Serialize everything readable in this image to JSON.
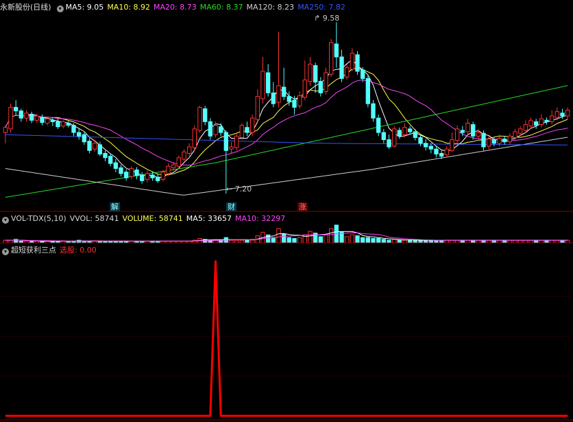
{
  "header": {
    "title": "永新股份(日线)",
    "ma": [
      {
        "label": "MA5: 9.05",
        "color": "#ffffff"
      },
      {
        "label": "MA10: 8.92",
        "color": "#ffff55"
      },
      {
        "label": "MA20: 8.73",
        "color": "#ff44ff"
      },
      {
        "label": "MA60: 8.37",
        "color": "#22dd22"
      },
      {
        "label": "MA120: 8.23",
        "color": "#d0d0d0"
      },
      {
        "label": "MA250: 7.82",
        "color": "#3355ff"
      }
    ]
  },
  "price_panel": {
    "high_label": "9.58",
    "low_label": "7.20",
    "events": [
      {
        "text": "解",
        "kind": "down"
      },
      {
        "text": "财",
        "kind": "down"
      },
      {
        "text": "涨",
        "kind": "up"
      }
    ]
  },
  "volume_header": {
    "name": "VOL-TDX(5,10)",
    "items": [
      {
        "label": "VVOL: 58741",
        "color": "#d8d8d8"
      },
      {
        "label": "VOLUME: 58741",
        "color": "#ffff55"
      },
      {
        "label": "MA5: 33657",
        "color": "#ffffff"
      },
      {
        "label": "MA10: 32297",
        "color": "#ff44ff"
      }
    ]
  },
  "indicator_header": {
    "name": "超短获利三点",
    "items": [
      {
        "label": "选股: 0.00",
        "color": "#ff3030"
      }
    ]
  },
  "colors": {
    "up": "#ff3232",
    "down": "#54ffff",
    "signal": "#ff0000",
    "grid": "#7a0000"
  },
  "chart_data": {
    "type": "candlestick",
    "candles": [
      [
        8.05,
        8.12,
        7.9,
        8.15
      ],
      [
        8.1,
        8.4,
        8.05,
        8.45
      ],
      [
        8.4,
        8.35,
        8.28,
        8.5
      ],
      [
        8.35,
        8.25,
        8.2,
        8.38
      ],
      [
        8.25,
        8.32,
        8.2,
        8.36
      ],
      [
        8.3,
        8.22,
        8.18,
        8.34
      ],
      [
        8.22,
        8.28,
        8.18,
        8.31
      ],
      [
        8.26,
        8.19,
        8.15,
        8.3
      ],
      [
        8.18,
        8.24,
        8.15,
        8.27
      ],
      [
        8.22,
        8.2,
        8.14,
        8.26
      ],
      [
        8.2,
        8.13,
        8.1,
        8.24
      ],
      [
        8.14,
        8.2,
        8.11,
        8.22
      ],
      [
        8.18,
        8.15,
        8.12,
        8.21
      ],
      [
        8.15,
        8.05,
        8.0,
        8.18
      ],
      [
        8.05,
        8.0,
        7.95,
        8.1
      ],
      [
        8.02,
        7.92,
        7.88,
        8.05
      ],
      [
        7.93,
        7.8,
        7.76,
        7.97
      ],
      [
        7.82,
        7.9,
        7.78,
        7.95
      ],
      [
        7.88,
        7.75,
        7.72,
        7.92
      ],
      [
        7.76,
        7.7,
        7.65,
        7.8
      ],
      [
        7.72,
        7.62,
        7.58,
        7.76
      ],
      [
        7.63,
        7.55,
        7.5,
        7.68
      ],
      [
        7.56,
        7.48,
        7.44,
        7.6
      ],
      [
        7.5,
        7.42,
        7.38,
        7.54
      ],
      [
        7.44,
        7.55,
        7.4,
        7.58
      ],
      [
        7.53,
        7.45,
        7.4,
        7.57
      ],
      [
        7.46,
        7.38,
        7.34,
        7.5
      ],
      [
        7.4,
        7.48,
        7.36,
        7.52
      ],
      [
        7.46,
        7.42,
        7.38,
        7.5
      ],
      [
        7.43,
        7.38,
        7.35,
        7.47
      ],
      [
        7.4,
        7.5,
        7.37,
        7.53
      ],
      [
        7.48,
        7.58,
        7.45,
        7.62
      ],
      [
        7.56,
        7.6,
        7.52,
        7.64
      ],
      [
        7.58,
        7.7,
        7.55,
        7.73
      ],
      [
        7.68,
        7.78,
        7.65,
        7.82
      ],
      [
        7.76,
        7.85,
        7.72,
        7.9
      ],
      [
        7.84,
        8.1,
        7.8,
        8.15
      ],
      [
        8.08,
        8.4,
        8.05,
        8.42
      ],
      [
        8.38,
        8.2,
        8.15,
        8.42
      ],
      [
        8.2,
        8.0,
        7.95,
        8.25
      ],
      [
        8.02,
        8.15,
        7.98,
        8.2
      ],
      [
        8.13,
        8.05,
        8.0,
        8.18
      ],
      [
        8.05,
        7.8,
        7.2,
        8.08
      ],
      [
        7.82,
        7.85,
        7.75,
        7.92
      ],
      [
        7.84,
        8.0,
        7.8,
        8.04
      ],
      [
        7.98,
        8.15,
        7.95,
        8.18
      ],
      [
        8.12,
        8.05,
        8.0,
        8.2
      ],
      [
        8.05,
        8.25,
        8.0,
        8.3
      ],
      [
        8.23,
        8.55,
        8.2,
        8.65
      ],
      [
        8.52,
        8.9,
        8.45,
        9.1
      ],
      [
        8.88,
        8.6,
        8.55,
        9.0
      ],
      [
        8.6,
        8.45,
        8.4,
        8.75
      ],
      [
        8.47,
        8.7,
        8.4,
        9.45
      ],
      [
        8.68,
        8.55,
        8.5,
        8.95
      ],
      [
        8.55,
        8.48,
        8.42,
        8.62
      ],
      [
        8.5,
        8.4,
        8.3,
        8.56
      ],
      [
        8.42,
        8.56,
        8.38,
        8.62
      ],
      [
        8.54,
        8.78,
        8.5,
        9.05
      ],
      [
        8.76,
        9.0,
        8.7,
        9.1
      ],
      [
        8.98,
        8.75,
        8.6,
        9.02
      ],
      [
        8.76,
        8.6,
        8.55,
        8.82
      ],
      [
        8.62,
        8.88,
        8.58,
        8.95
      ],
      [
        8.86,
        9.3,
        8.82,
        9.35
      ],
      [
        9.28,
        9.1,
        8.95,
        9.58
      ],
      [
        9.1,
        8.8,
        8.75,
        9.2
      ],
      [
        8.82,
        8.95,
        8.78,
        9.0
      ],
      [
        8.93,
        9.15,
        8.9,
        9.22
      ],
      [
        9.13,
        8.9,
        8.85,
        9.18
      ],
      [
        8.92,
        8.8,
        8.75,
        8.96
      ],
      [
        8.8,
        8.45,
        8.4,
        8.85
      ],
      [
        8.45,
        8.25,
        8.2,
        8.5
      ],
      [
        8.25,
        8.05,
        8.0,
        8.3
      ],
      [
        8.05,
        7.95,
        7.9,
        8.1
      ],
      [
        7.95,
        7.85,
        7.82,
        8.02
      ],
      [
        7.86,
        8.1,
        7.84,
        8.14
      ],
      [
        8.08,
        8.0,
        7.96,
        8.12
      ],
      [
        8.02,
        8.12,
        7.98,
        8.18
      ],
      [
        8.1,
        8.06,
        8.02,
        8.14
      ],
      [
        8.06,
        7.98,
        7.94,
        8.1
      ],
      [
        7.98,
        7.9,
        7.86,
        8.02
      ],
      [
        7.9,
        7.85,
        7.8,
        7.96
      ],
      [
        7.86,
        7.82,
        7.76,
        7.9
      ],
      [
        7.82,
        7.75,
        7.7,
        7.86
      ],
      [
        7.76,
        7.72,
        7.68,
        7.8
      ],
      [
        7.74,
        7.82,
        7.7,
        7.86
      ],
      [
        7.8,
        7.95,
        7.78,
        8.05
      ],
      [
        7.94,
        8.1,
        7.9,
        8.15
      ],
      [
        8.08,
        8.05,
        8.0,
        8.14
      ],
      [
        8.06,
        8.18,
        8.02,
        8.24
      ],
      [
        8.16,
        8.0,
        7.95,
        8.2
      ],
      [
        8.0,
        8.05,
        7.96,
        8.1
      ],
      [
        8.04,
        7.85,
        7.8,
        8.08
      ],
      [
        7.86,
        7.96,
        7.82,
        8.0
      ],
      [
        7.95,
        7.9,
        7.86,
        7.98
      ],
      [
        7.9,
        7.97,
        7.86,
        8.02
      ],
      [
        7.96,
        7.92,
        7.88,
        8.0
      ],
      [
        7.92,
        8.0,
        7.88,
        8.04
      ],
      [
        7.98,
        8.06,
        7.94,
        8.1
      ],
      [
        8.04,
        8.1,
        8.0,
        8.14
      ],
      [
        8.08,
        8.16,
        8.04,
        8.22
      ],
      [
        8.14,
        8.22,
        8.1,
        8.26
      ],
      [
        8.2,
        8.15,
        8.1,
        8.24
      ],
      [
        8.16,
        8.24,
        8.12,
        8.3
      ],
      [
        8.22,
        8.2,
        8.16,
        8.26
      ],
      [
        8.2,
        8.28,
        8.16,
        8.36
      ],
      [
        8.26,
        8.34,
        8.22,
        8.4
      ],
      [
        8.32,
        8.28,
        8.24,
        8.38
      ],
      [
        8.28,
        8.36,
        8.24,
        8.4
      ]
    ],
    "price_range": [
      7.05,
      9.7
    ],
    "volume": [
      3,
      3,
      4,
      2,
      2,
      2,
      2,
      2,
      2,
      2,
      2,
      2,
      2,
      2,
      3,
      2,
      2,
      2,
      2,
      2,
      2,
      2,
      2,
      2,
      2,
      2,
      2,
      2,
      2,
      2,
      2,
      2,
      2,
      2,
      2,
      2,
      3,
      5,
      4,
      3,
      3,
      3,
      6,
      3,
      3,
      3,
      3,
      4,
      8,
      12,
      9,
      6,
      16,
      10,
      6,
      5,
      6,
      9,
      13,
      11,
      7,
      9,
      16,
      20,
      12,
      7,
      9,
      8,
      6,
      6,
      5,
      5,
      4,
      3,
      4,
      3,
      3,
      3,
      3,
      3,
      3,
      3,
      3,
      3,
      3,
      3,
      3,
      3,
      3,
      3,
      3,
      3,
      3,
      3,
      3,
      3,
      3,
      3,
      3,
      3,
      3,
      3,
      3,
      3,
      3,
      3,
      3,
      3
    ],
    "signal": {
      "peak_index": 40,
      "peak": 1.0,
      "base": 0.0,
      "ylim": [
        0,
        1.03
      ]
    }
  }
}
